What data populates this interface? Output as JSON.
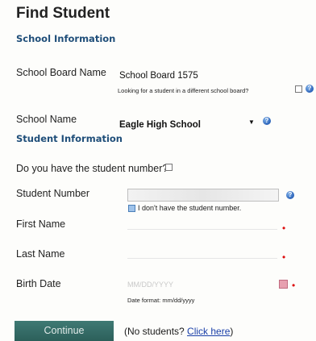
{
  "page": {
    "title": "Find Student",
    "school_section": "School Information",
    "student_section": "Student Information"
  },
  "school_board": {
    "label": "School Board Name",
    "value": "School Board 1575",
    "different_board_question": "Looking for a student in a different school board?"
  },
  "school": {
    "label": "School Name",
    "selected": "Eagle High School"
  },
  "student_number_question": "Do you have the student number?",
  "student_number": {
    "label": "Student Number",
    "no_number_label": "I don't have the student number."
  },
  "first_name": {
    "label": "First Name"
  },
  "last_name": {
    "label": "Last Name"
  },
  "birth_date": {
    "label": "Birth Date",
    "placeholder": "MM/DD/YYYY",
    "format_hint": "Date format: mm/dd/yyyy"
  },
  "actions": {
    "continue": "Continue",
    "no_students_prefix": "(No students? ",
    "click_here": "Click here",
    "no_students_suffix": ")"
  },
  "icons": {
    "help": "help-icon",
    "calendar": "calendar-icon",
    "dropdown": "chevron-down-icon"
  },
  "colors": {
    "section_heading": "#1f4e79",
    "button": "#2c5f5a",
    "required": "#dd1111",
    "link": "#1a3fa8"
  }
}
